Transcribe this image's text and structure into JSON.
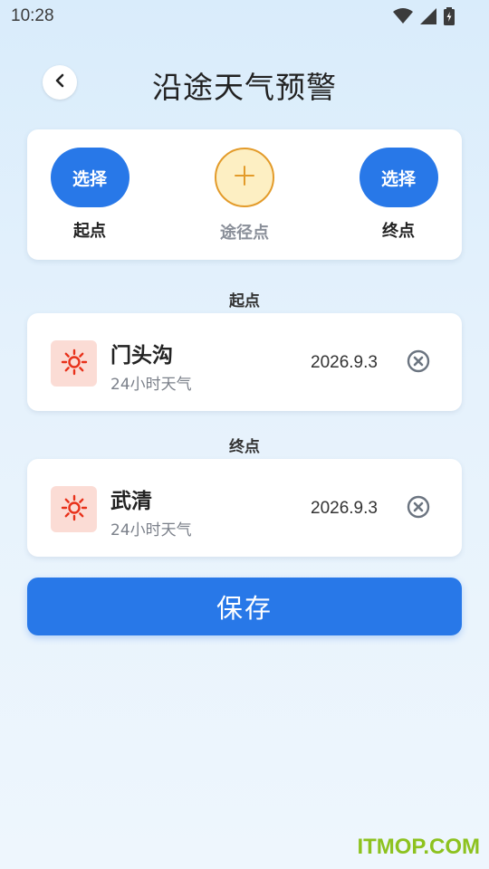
{
  "status_bar": {
    "time": "10:28"
  },
  "header": {
    "title": "沿途天气预警"
  },
  "route": {
    "start": {
      "button_label": "选择",
      "label": "起点"
    },
    "waypoint": {
      "label": "途径点"
    },
    "end": {
      "button_label": "选择",
      "label": "终点"
    }
  },
  "sections": {
    "start_label": "起点",
    "end_label": "终点"
  },
  "points": [
    {
      "name": "门头沟",
      "subtitle": "24小时天气",
      "date": "2026.9.3",
      "icon": "sun-icon"
    },
    {
      "name": "武清",
      "subtitle": "24小时天气",
      "date": "2026.9.3",
      "icon": "sun-icon"
    }
  ],
  "save_label": "保存",
  "watermark": "ITMOP.COM",
  "colors": {
    "primary": "#2878e8",
    "sun": "#e8311a",
    "sun_bg": "#fbdcd5",
    "add_border": "#e39b2a",
    "add_bg": "#fdefc3"
  }
}
